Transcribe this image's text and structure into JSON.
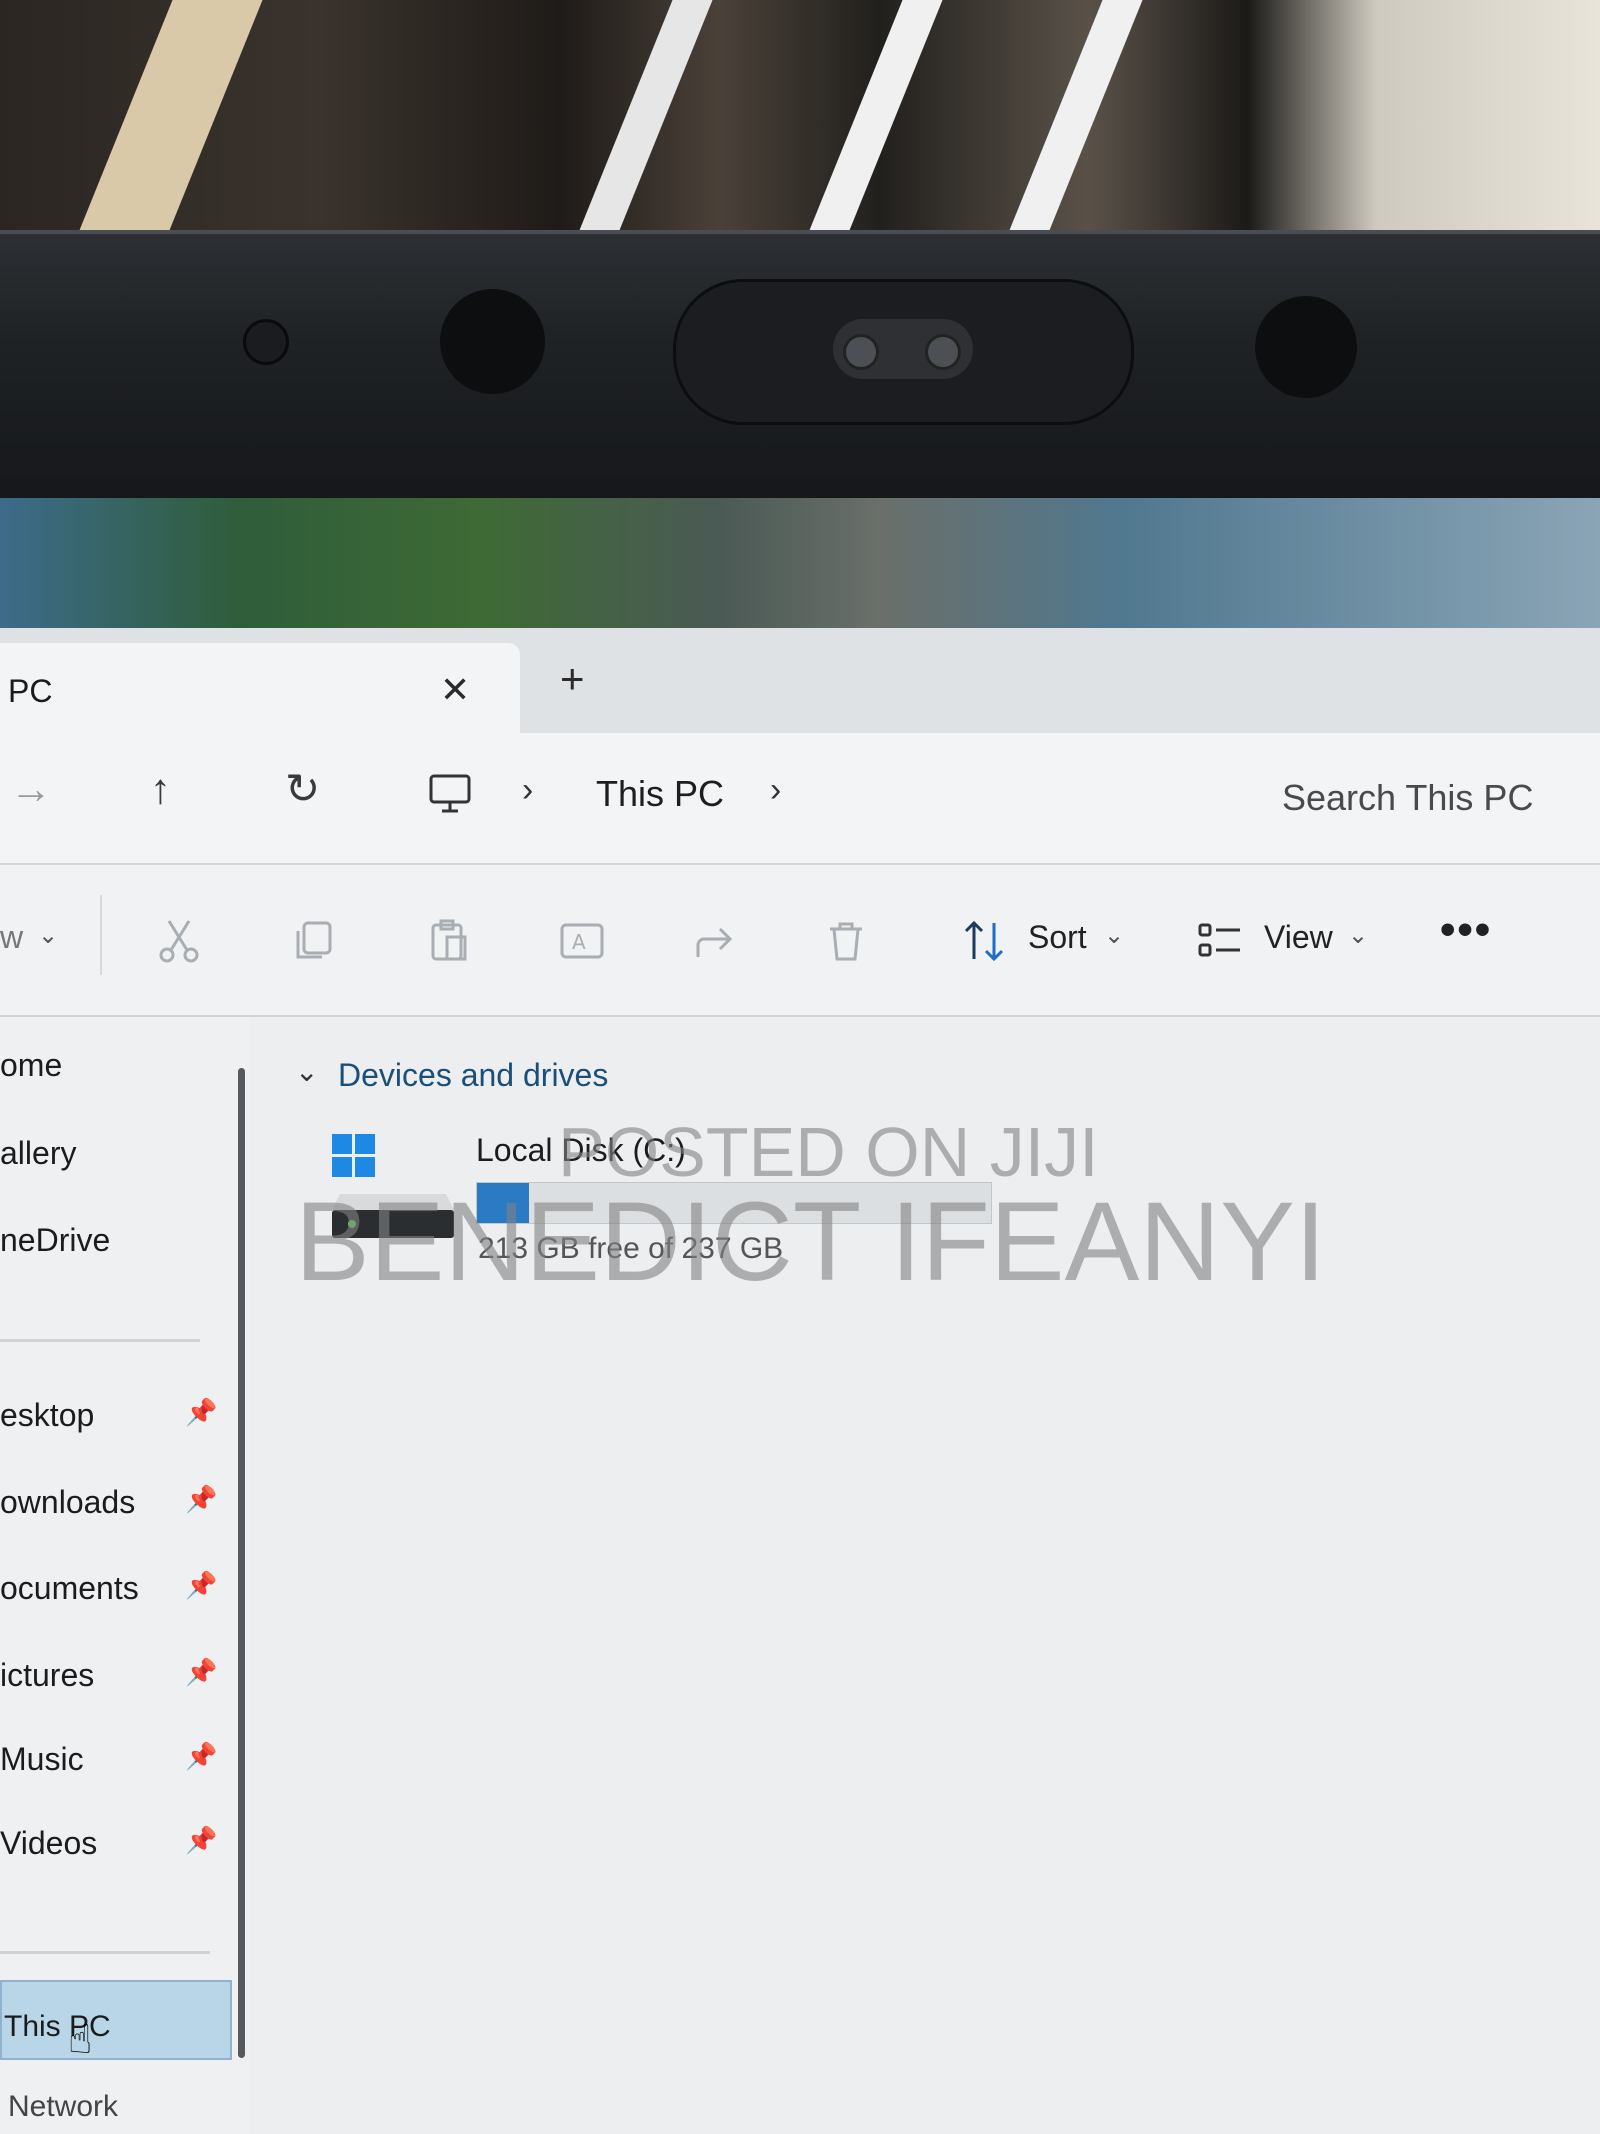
{
  "window": {
    "tab_title": "PC",
    "tab_close": "✕",
    "new_tab": "+"
  },
  "address_bar": {
    "forward_icon": "→",
    "up_icon": "↑",
    "refresh_icon": "↻",
    "breadcrumb": [
      "This PC"
    ],
    "search_placeholder": "Search This PC"
  },
  "command_bar": {
    "new_label_partial": "w",
    "sort_label": "Sort",
    "view_label": "View",
    "more_label": "•••"
  },
  "sidebar": {
    "items_top": [
      "ome",
      "allery",
      "neDrive"
    ],
    "items_pinned": [
      "esktop",
      "ownloads",
      "ocuments",
      "ictures",
      "Music",
      "Videos"
    ],
    "selected": "This PC",
    "network": "Network"
  },
  "content": {
    "group_label": "Devices and drives",
    "drives": [
      {
        "name": "Local Disk (C:)",
        "free_text": "213 GB free of 237 GB",
        "used_fraction": 0.101
      }
    ]
  },
  "watermarks": [
    "POSTED ON JIJI",
    "BENEDICT IFEANYI"
  ],
  "colors": {
    "accent": "#2a7ac4",
    "selection": "#b9d5e8",
    "group_label": "#1a4f7a"
  }
}
